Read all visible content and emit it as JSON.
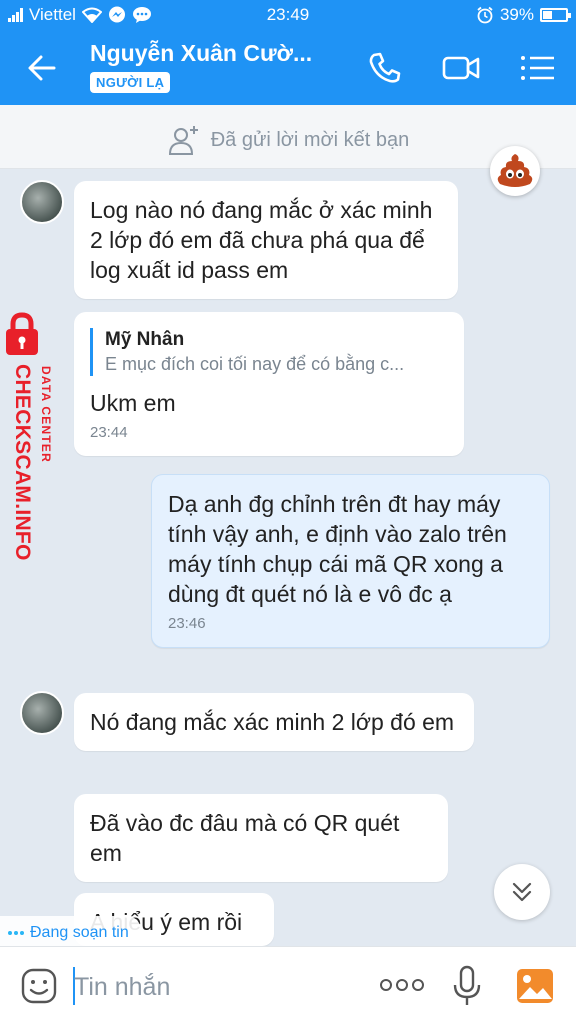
{
  "status_bar": {
    "carrier": "Viettel",
    "time": "23:49",
    "battery": "39%",
    "battery_level": 0.39
  },
  "header": {
    "contact_name": "Nguyễn Xuân Cườ...",
    "badge": "NGƯỜI LẠ"
  },
  "friend_request": {
    "text": "Đã gửi lời mời kết bạn"
  },
  "messages": [
    {
      "direction": "in",
      "text": "Log nào nó đang mắc ở xác minh 2 lớp đó em đã chưa phá qua để log xuất id pass em"
    },
    {
      "direction": "in",
      "quote_name": "Mỹ Nhân",
      "quote_text": "E mục đích coi tối nay để có bằng c...",
      "text": "Ukm em",
      "time": "23:44"
    },
    {
      "direction": "out",
      "text": "Dạ anh đg chỉnh trên đt hay máy tính vậy anh, e định vào zalo trên máy tính chụp cái mã QR xong a dùng đt quét nó là e vô đc ạ",
      "time": "23:46"
    },
    {
      "direction": "in",
      "text": "Nó đang mắc xác minh 2 lớp đó em"
    },
    {
      "direction": "in",
      "text": "Đã vào đc đâu mà có QR quét em"
    },
    {
      "direction": "in",
      "text": "A hiểu ý em rồi"
    }
  ],
  "typing_indicator": "Đang soạn tin",
  "watermark": {
    "line1": "DATA CENTER",
    "line2": "CHECKSCAM.INFO"
  },
  "input": {
    "placeholder": "Tin nhắn"
  },
  "colors": {
    "header_blue": "#1f93f5",
    "chat_background": "#e2e9f1",
    "outgoing_bubble": "#e5f1fe",
    "watermark_red": "#e8202a"
  }
}
